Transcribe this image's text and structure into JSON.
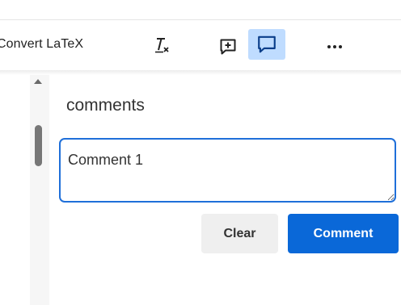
{
  "toolbar": {
    "convert_latex_label": "Convert LaTeX",
    "icons": {
      "clear_formatting": "clear-formatting-icon",
      "insert_comment": "insert-comment-icon",
      "show_comments": "comment-icon",
      "more": "more-horizontal-icon"
    },
    "active_color": "#bfdcff"
  },
  "panel": {
    "heading": "comments",
    "comment_input_value": "Comment 1",
    "clear_label": "Clear",
    "comment_label": "Comment",
    "accent_color": "#0a68d8"
  }
}
